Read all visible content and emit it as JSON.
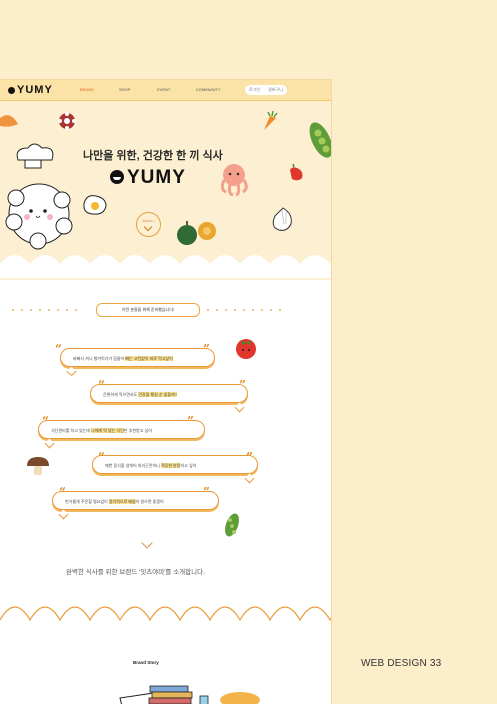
{
  "nav": {
    "logo": "YUMY",
    "items": [
      "BRAND",
      "SHOP",
      "EVENT",
      "COMMUNITY"
    ],
    "right": [
      "로그인",
      "장바구니"
    ]
  },
  "hero": {
    "title": "나만을 위한, 건강한 한 끼 식사",
    "logo": "YUMY",
    "scroll_label": "SCROLL"
  },
  "section": {
    "title": "이런 분들을 위해 준비했습니다!",
    "bubbles": [
      {
        "pre": "바빠서 끼니 챙겨먹기가 힘들어 ",
        "hl": "빠는 고민없이 바로 먹고싶어",
        "post": ""
      },
      {
        "pre": "간편하게 먹으면서도 ",
        "hl": "건강을 챙길 순 없을까?",
        "post": ""
      },
      {
        "pre": "식단관리를 하고 있는데 ",
        "hl": "나에게 딱 맞는 식단",
        "post": "만 추천받고 싶어"
      },
      {
        "pre": "매번 음식을 냉게어 처리곤란하니 ",
        "hl": "적당한 분량",
        "post": "하고 싶어"
      },
      {
        "pre": "번거롭게 주문할 필요없이 ",
        "hl": "정기적으로 배송",
        "post": "이 왔으면 좋겠어"
      }
    ],
    "intro": "완벽한 식사를 위한 브랜드 '잇츠야미'를 소개합니다.",
    "brand_story": "Brand Story"
  },
  "side_label": "WEB DESIGN   33",
  "colors": {
    "accent": "#e99a35",
    "background": "#fdeecb",
    "nav": "#fbe3a8",
    "hero": "#fdf0d2"
  }
}
